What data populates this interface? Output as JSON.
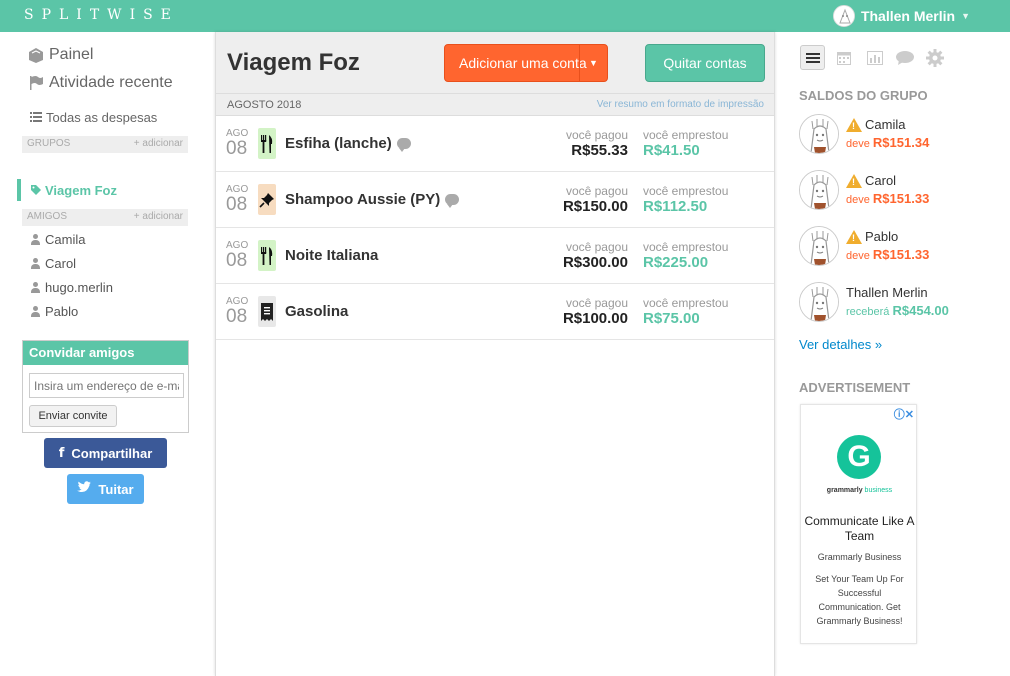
{
  "topbar": {
    "logo": "SPLITWISE",
    "user_name": "Thallen Merlin"
  },
  "left": {
    "nav": [
      {
        "label": "Painel",
        "icon": "logo-icon"
      },
      {
        "label": "Atividade recente",
        "icon": "flag-icon"
      }
    ],
    "all_expenses": "Todas as despesas",
    "groups_header": "GRUPOS",
    "groups_add": "+ adicionar",
    "groups": [
      "Viagem Foz"
    ],
    "friends_header": "AMIGOS",
    "friends_add": "+ adicionar",
    "friends": [
      "Camila",
      "Carol",
      "hugo.merlin",
      "Pablo"
    ],
    "invite": {
      "title": "Convidar amigos",
      "placeholder": "Insira um endereço de e-mail",
      "button": "Enviar convite"
    },
    "share_facebook": "Compartilhar",
    "share_twitter": "Tuitar"
  },
  "main": {
    "title": "Viagem Foz",
    "add_button": "Adicionar uma conta",
    "settle_button": "Quitar contas",
    "month": "AGOSTO 2018",
    "print_link": "Ver resumo em formato de impressão",
    "expenses": [
      {
        "month": "AGO",
        "day": "08",
        "description": "Esfiha (lanche)",
        "category_icon": "fork-knife-icon",
        "category_color": "#d3f3c6",
        "has_comment": true,
        "paid_label": "você pagou",
        "paid": "R$55.33",
        "lent_label": "você emprestou",
        "lent": "R$41.50"
      },
      {
        "month": "AGO",
        "day": "08",
        "description": "Shampoo Aussie (PY)",
        "category_icon": "pin-icon",
        "category_color": "#f7dcc0",
        "has_comment": true,
        "paid_label": "você pagou",
        "paid": "R$150.00",
        "lent_label": "você emprestou",
        "lent": "R$112.50"
      },
      {
        "month": "AGO",
        "day": "08",
        "description": "Noite Italiana",
        "category_icon": "fork-knife-icon",
        "category_color": "#d3f3c6",
        "has_comment": false,
        "paid_label": "você pagou",
        "paid": "R$300.00",
        "lent_label": "você emprestou",
        "lent": "R$225.00"
      },
      {
        "month": "AGO",
        "day": "08",
        "description": "Gasolina",
        "category_icon": "receipt-icon",
        "category_color": "#e8e8e8",
        "has_comment": false,
        "paid_label": "você pagou",
        "paid": "R$100.00",
        "lent_label": "você emprestou",
        "lent": "R$75.00"
      }
    ]
  },
  "right": {
    "balances_title": "SALDOS DO GRUPO",
    "balances": [
      {
        "name": "Camila",
        "warning": true,
        "status": "deve",
        "amount": "R$151.34",
        "type": "owe"
      },
      {
        "name": "Carol",
        "warning": true,
        "status": "deve",
        "amount": "R$151.33",
        "type": "owe"
      },
      {
        "name": "Pablo",
        "warning": true,
        "status": "deve",
        "amount": "R$151.33",
        "type": "owe"
      },
      {
        "name": "Thallen Merlin",
        "warning": false,
        "status": "receberá",
        "amount": "R$454.00",
        "type": "get"
      }
    ],
    "details_link": "Ver detalhes »",
    "ad_title": "ADVERTISEMENT",
    "ad": {
      "brand": "grammarly",
      "brand_sub": "business",
      "headline": "Communicate Like A Team",
      "sub": "Grammarly Business",
      "body": "Set Your Team Up For Successful Communication. Get Grammarly Business!"
    }
  },
  "colors": {
    "brand": "#5bc5a7",
    "add_button": "#ff652f",
    "owe": "#ff652f",
    "lent": "#5bc5a7"
  }
}
